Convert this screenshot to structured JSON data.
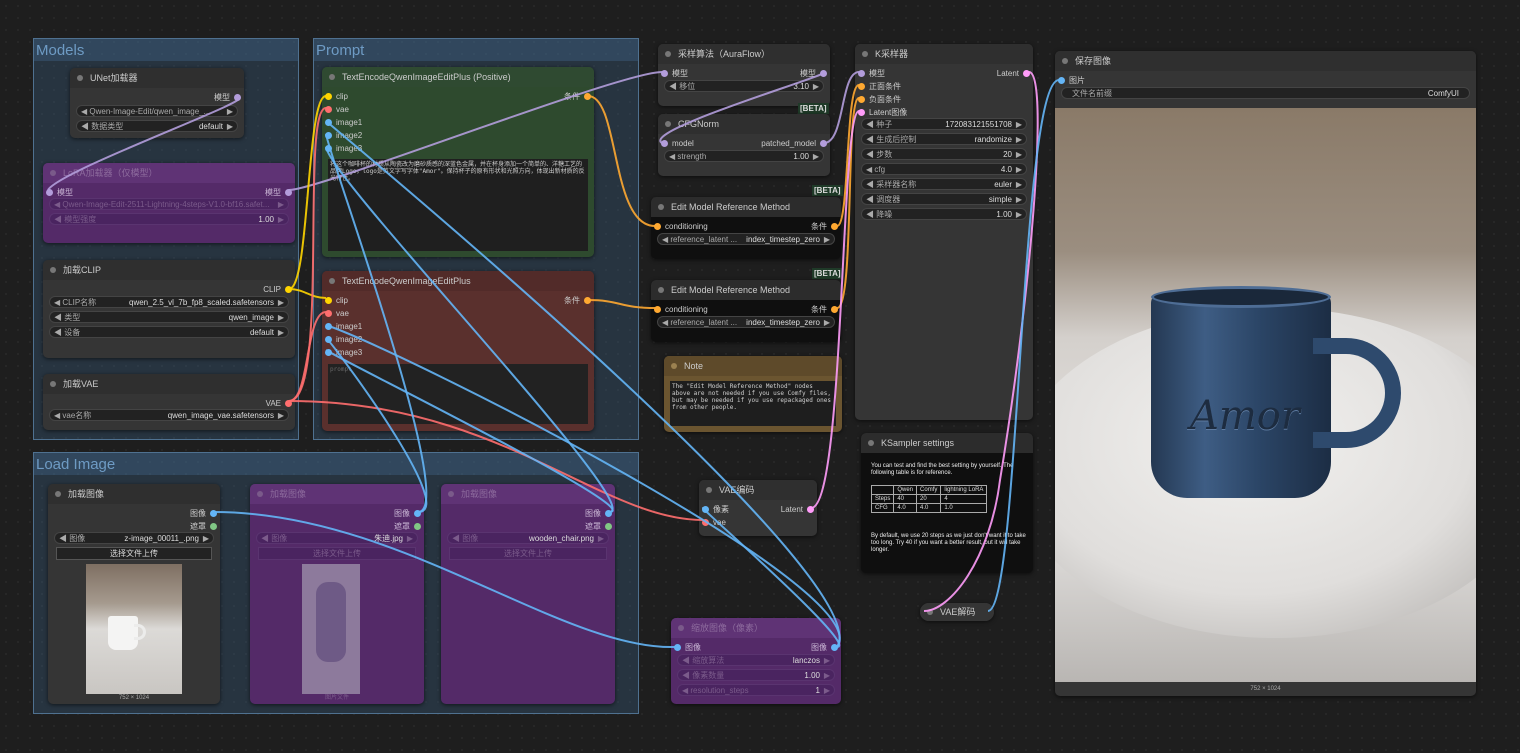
{
  "groups": {
    "models": "Models",
    "prompt": "Prompt",
    "load_image": "Load Image"
  },
  "colors": {
    "clip": "#ffd500",
    "model": "#b39ddb",
    "latent": "#ff9cf9",
    "image": "#64b5f6",
    "vae": "#ff6e6e",
    "cond": "#ffa931",
    "mask": "#81c784"
  },
  "unet": {
    "title": "UNet加载器",
    "out": "模型",
    "w1": "Qwen-Image-Edit/qwen_image_...",
    "w2l": "数据类型",
    "w2v": "default"
  },
  "lora": {
    "title": "LoRA加载器（仅模型）",
    "in": "模型",
    "out": "模型",
    "w1": "Qwen-Image-Edit-2511-Lightning-4steps-V1.0-bf16.safet...",
    "w2l": "模型强度",
    "w2v": "1.00"
  },
  "clip": {
    "title": "加载CLIP",
    "out": "CLIP",
    "w1l": "CLIP名称",
    "w1v": "qwen_2.5_vl_7b_fp8_scaled.safetensors",
    "w2l": "类型",
    "w2v": "qwen_image",
    "w3l": "设备",
    "w3v": "default"
  },
  "vae": {
    "title": "加载VAE",
    "out": "VAE",
    "w1l": "vae名称",
    "w1v": "qwen_image_vae.safetensors"
  },
  "pos": {
    "title": "TextEncodeQwenImageEditPlus (Positive)",
    "i1": "clip",
    "i2": "vae",
    "i3": "image1",
    "i4": "image2",
    "i5": "image3",
    "out": "条件",
    "text": "将这个咖啡杯的材质从陶瓷改为磨砂质感的深蓝色金属，并在杯身添加一个简单的、洋糖工艺的品牌Logo，logo是英文字写字体\"Amor\"。保持杯子的原有形状和光照方向，体现出新材质的反光特性。"
  },
  "neg": {
    "title": "TextEncodeQwenImageEditPlus",
    "i1": "clip",
    "i2": "vae",
    "i3": "image1",
    "i4": "image2",
    "i5": "image3",
    "out": "条件",
    "placeholder": "prompt"
  },
  "aura": {
    "title": "采样算法（AuraFlow）",
    "in": "模型",
    "out": "模型",
    "wl": "移位",
    "wv": "3.10"
  },
  "cfgnorm": {
    "title": "CFGNorm",
    "in": "model",
    "out": "patched_model",
    "wl": "strength",
    "wv": "1.00"
  },
  "beta": "[BETA]",
  "emr1": {
    "title": "Edit Model Reference Method",
    "in": "conditioning",
    "out": "条件",
    "wl": "reference_latent ...",
    "wv": "index_timestep_zero"
  },
  "emr2": {
    "title": "Edit Model Reference Method",
    "in": "conditioning",
    "out": "条件",
    "wl": "reference_latent ...",
    "wv": "index_timestep_zero"
  },
  "note": {
    "title": "Note",
    "text": "The \"Edit Model Reference Method\" nodes above are not needed if you use Comfy files, but may be needed if you use repackaged ones from other people."
  },
  "ksampler": {
    "title": "K采样器",
    "i1": "模型",
    "i2": "正面条件",
    "i3": "负面条件",
    "i4": "Latent图像",
    "out": "Latent",
    "w": [
      [
        "种子",
        "172083121551708"
      ],
      [
        "生成后控制",
        "randomize"
      ],
      [
        "步数",
        "20"
      ],
      [
        "cfg",
        "4.0"
      ],
      [
        "采样器名称",
        "euler"
      ],
      [
        "调度器",
        "simple"
      ],
      [
        "降噪",
        "1.00"
      ]
    ]
  },
  "ksettings": {
    "title": "KSampler settings",
    "p1": "You can test and find the best setting by yourself. The following table is for reference.",
    "table": [
      [
        "",
        "Qwen",
        "Comfy",
        "lightning LoRA"
      ],
      [
        "Steps",
        "40",
        "20",
        "4"
      ],
      [
        "CFG",
        "4.0",
        "4.0",
        "1.0"
      ]
    ],
    "p2": "By default, we use 20 steps as we just don't want it to take too long. Try 40 if you want a better result, but it will take longer."
  },
  "save": {
    "title": "保存图像",
    "in": "图片",
    "wl": "文件名前缀",
    "wv": "ComfyUI",
    "size": "752 × 1024",
    "mug_text": "Amor"
  },
  "load1": {
    "title": "加载图像",
    "o1": "图像",
    "o2": "遮罩",
    "wl": "图像",
    "wv": "z-image_00011_.png",
    "btn": "选择文件上传",
    "size": "752 × 1024"
  },
  "load2": {
    "title": "加载图像",
    "o1": "图像",
    "o2": "遮罩",
    "wl": "图像",
    "wv": "朱迪.jpg",
    "btn": "选择文件上传",
    "size": "图片文件"
  },
  "load3": {
    "title": "加载图像",
    "o1": "图像",
    "o2": "遮罩",
    "wl": "图像",
    "wv": "wooden_chair.png",
    "btn": "选择文件上传"
  },
  "vaeenc": {
    "title": "VAE编码",
    "i1": "像素",
    "i2": "vae",
    "out": "Latent"
  },
  "vaedec": {
    "title": "VAE解码"
  },
  "scale": {
    "title": "缩放图像（像素）",
    "in": "图像",
    "out": "图像",
    "w": [
      [
        "缩放算法",
        "lanczos"
      ],
      [
        "像素数量",
        "1.00"
      ],
      [
        "resolution_steps",
        "1"
      ]
    ]
  }
}
